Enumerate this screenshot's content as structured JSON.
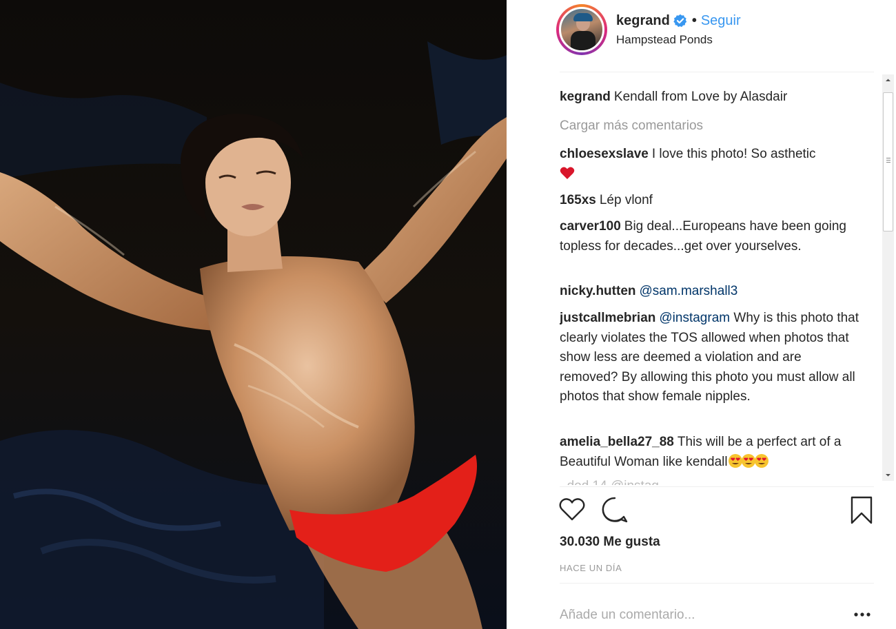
{
  "post": {
    "photo_alt": "",
    "author": {
      "username": "kegrand",
      "verified": true,
      "separator": "•",
      "follow_label": "Seguir",
      "location": "Hampstead Ponds"
    },
    "caption": {
      "username": "kegrand",
      "text": "Kendall from Love by Alasdair"
    },
    "load_more_label": "Cargar más comentarios",
    "comments": [
      {
        "username": "chloesexslave",
        "text": "I love this photo! So asthetic",
        "emoji": "red-heart"
      },
      {
        "username": "165xs",
        "text": "Lép vlonf"
      },
      {
        "username": "carver100",
        "text": "Big deal...Europeans have been going topless for decades...get over yourselves."
      },
      {
        "username": "nicky.hutten",
        "mention": "@sam.marshall3",
        "text": ""
      },
      {
        "username": "justcallmebrian",
        "mention": "@instagram",
        "text": "Why is this photo that clearly violates the TOS allowed when photos that show less are deemed a violation and are removed? By allowing this photo you must allow all photos that show female nipples."
      },
      {
        "username": "amelia_bella27_88",
        "text": "This will be a perfect art of a Beautiful Woman like kendall",
        "emoji": "heart-eyes-x3"
      }
    ],
    "cut_off_comment": "_dod 14 @instag",
    "actions": {
      "like_icon": "heart-outline-icon",
      "comment_icon": "speech-bubble-icon",
      "save_icon": "bookmark-icon"
    },
    "likes_label": "30.030 Me gusta",
    "timestamp": "HACE UN DÍA",
    "comment_input_placeholder": "Añade un comentario...",
    "more_options_icon": "ellipsis-icon"
  },
  "colors": {
    "link_blue": "#3897f0",
    "mention_blue": "#003569",
    "muted_gray": "#999999",
    "verified_blue": "#3897f0",
    "avatar_ring": [
      "#f58529",
      "#dd2a7b",
      "#8134af"
    ]
  }
}
